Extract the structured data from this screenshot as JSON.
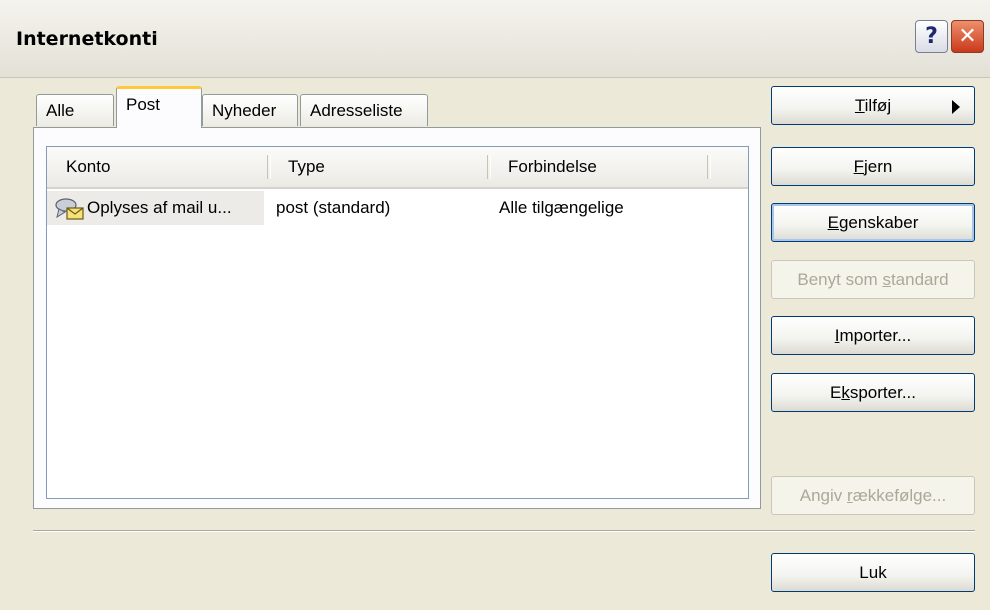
{
  "window": {
    "title": "Internetkonti",
    "help_glyph": "?",
    "close_glyph": "✕"
  },
  "tabs": [
    {
      "label": "Alle",
      "selected": false
    },
    {
      "label": "Post",
      "selected": true
    },
    {
      "label": "Nyheder",
      "selected": false
    },
    {
      "label": "Adresseliste",
      "selected": false
    }
  ],
  "list": {
    "columns": [
      "Konto",
      "Type",
      "Forbindelse"
    ],
    "rows": [
      {
        "account": "Oplyses af mail u...",
        "type": "post (standard)",
        "connection": "Alle tilgængelige",
        "icon": "mail-account-icon"
      }
    ]
  },
  "buttons": {
    "add": {
      "pre": "",
      "ul": "T",
      "post": "ilføj"
    },
    "remove": {
      "pre": "",
      "ul": "F",
      "post": "jern"
    },
    "properties": {
      "pre": "",
      "ul": "E",
      "post": "genskaber"
    },
    "set_default": {
      "pre": "Benyt som ",
      "ul": "s",
      "post": "tandard"
    },
    "import": {
      "pre": "",
      "ul": "I",
      "post": "mporter..."
    },
    "export": {
      "pre": "E",
      "ul": "k",
      "post": "sporter..."
    },
    "order": {
      "pre": "Angiv ",
      "ul": "r",
      "post": "ækkefølge..."
    },
    "close": {
      "pre": "Luk",
      "ul": "",
      "post": ""
    }
  }
}
